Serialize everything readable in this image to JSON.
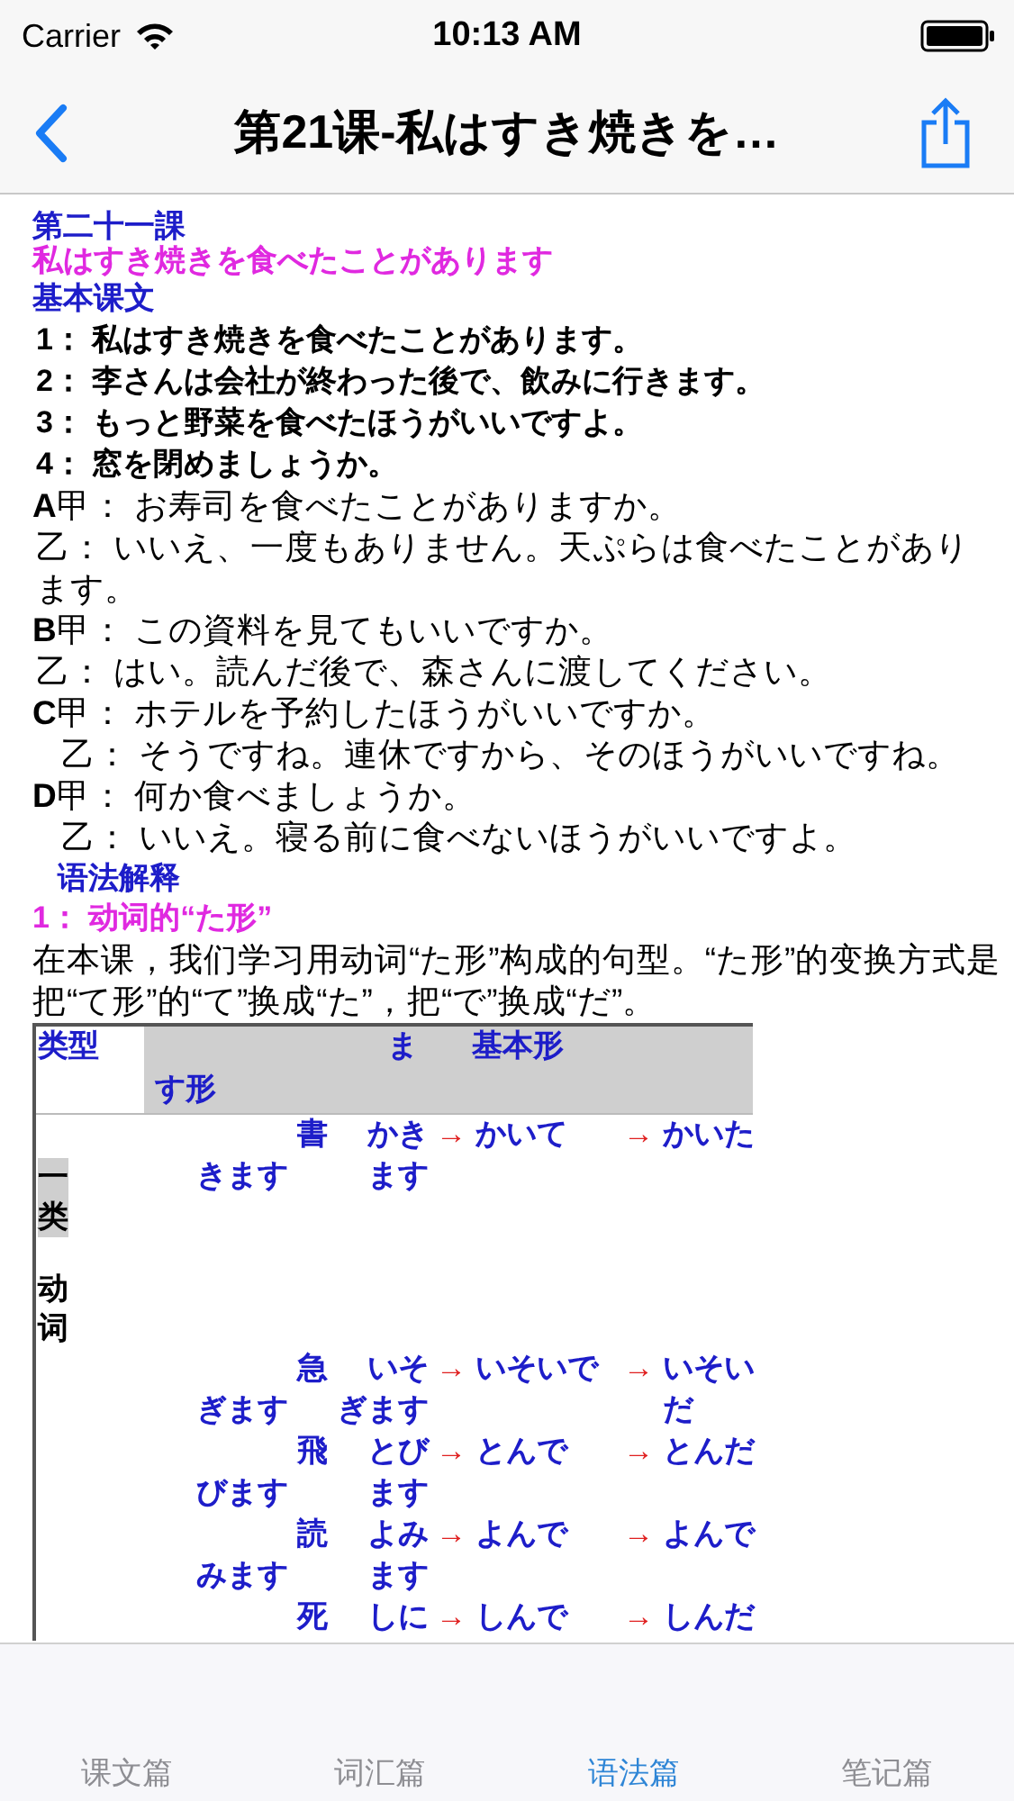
{
  "status_bar": {
    "carrier": "Carrier",
    "time": "10:13 AM"
  },
  "nav_bar": {
    "title": "第21课-私はすき焼きを…"
  },
  "content": {
    "lesson_number": "第二十一課",
    "lesson_title": "私はすき焼きを食べたことがあります",
    "section_heading": "基本课文",
    "sentences": [
      "1： 私はすき焼きを食べたことがあります。",
      "2： 李さんは会社が終わった後で、飲みに行きます。",
      "3： もっと野菜を食べたほうがいいですよ。",
      "4： 窓を閉めましょうか。"
    ],
    "dialogues": [
      {
        "kind": "question",
        "text": "**A**甲： お寿司を食べたことがありますか。"
      },
      {
        "kind": "answer",
        "text": "乙： いいえ、一度もありません。天ぷらは食べたことがあります。"
      },
      {
        "kind": "question",
        "text": "**B**甲： この資料を見てもいいですか。"
      },
      {
        "kind": "answer",
        "text": "乙： はい。読んだ後で、森さんに渡してください。"
      },
      {
        "kind": "question",
        "text": "**C**甲： ホテルを予約したほうがいいですか。"
      },
      {
        "kind": "answer_deep",
        "text": "乙： そうですね。連休ですから、そのほうがいいですね。"
      },
      {
        "kind": "question",
        "text": "**D**甲： 何か食べましょうか。"
      },
      {
        "kind": "answer_deep",
        "text": "乙： いいえ。寝る前に食べないほうがいいですよ。"
      }
    ],
    "grammar_heading": "语法解释",
    "grammar_point": "1： 动词的“た形”",
    "paragraph": "在本课，我们学习用动词“た形”构成的句型。“た形”的变换方式是把“て形”的“て”换成“た”，把“で”换成“だ”。",
    "table": {
      "header": {
        "column_1": "类型",
        "column_3_line_1": "ま",
        "column_2_line_2": "す形",
        "column_4": "基本形"
      },
      "rows": [
        {
          "category": [
            {
              "text": "一类",
              "highlighted": true
            },
            {
              "text": "动词",
              "highlighted": false
            }
          ],
          "lines": [
            {
              "column_2": "書",
              "column_3": "かき",
              "column_4": {
                "arrow": "→",
                "text": "かいて"
              },
              "column_5": {
                "arrow": "→",
                "text": "かいた"
              }
            },
            {
              "column_1": "きます",
              "column_3": "ます"
            }
          ]
        },
        {
          "lines": [
            {
              "column_2": "急",
              "column_3": "いそ",
              "column_4": {
                "arrow": "→",
                "text": "いそいで"
              },
              "column_5": {
                "arrow": "→",
                "text": "いそい"
              }
            },
            {
              "column_1": "ぎます",
              "column_3": "ぎます",
              "column_5": {
                "text": "だ"
              }
            }
          ]
        },
        {
          "lines": [
            {
              "column_2": "飛",
              "column_3": "とび",
              "column_4": {
                "arrow": "→",
                "text": "とんで"
              },
              "column_5": {
                "arrow": "→",
                "text": "とんだ"
              }
            },
            {
              "column_1": "びます",
              "column_3": "ます"
            }
          ]
        },
        {
          "lines": [
            {
              "column_2": "読",
              "column_3": "よみ",
              "column_4": {
                "arrow": "→",
                "text": "よんで"
              },
              "column_5": {
                "arrow": "→",
                "text": "よんで"
              }
            },
            {
              "column_1": "みます",
              "column_3": "ます"
            }
          ]
        },
        {
          "lines": [
            {
              "column_2": "死",
              "column_3": "しに",
              "column_4": {
                "arrow": "→",
                "text": "しんで"
              },
              "column_5": {
                "arrow": "→",
                "text": "しんだ"
              }
            }
          ]
        }
      ]
    }
  },
  "tab_bar": [
    {
      "label": "课文篇",
      "selected": false
    },
    {
      "label": "词汇篇",
      "selected": false
    },
    {
      "label": "语法篇",
      "selected": true
    },
    {
      "label": "笔记篇",
      "selected": false
    }
  ]
}
